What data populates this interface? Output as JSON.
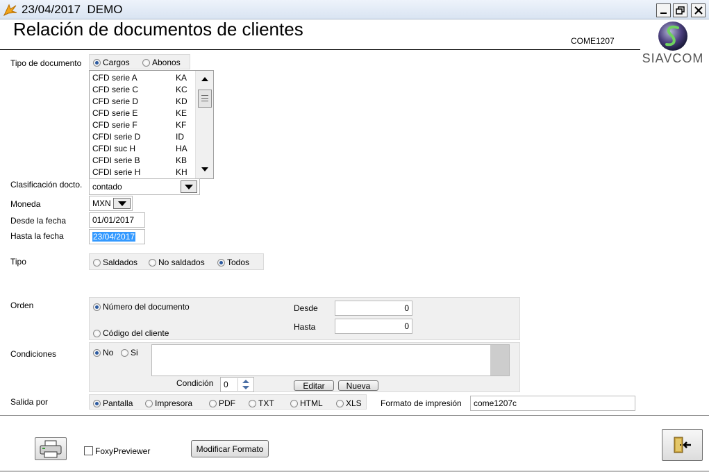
{
  "window": {
    "title": "23/04/2017  DEMO"
  },
  "header": {
    "title": "Relación de documentos de clientes",
    "form_code": "COME1207",
    "logo_text": "SIAVCOM"
  },
  "tipo_documento": {
    "label": "Tipo de documento",
    "options": [
      "Cargos",
      "Abonos"
    ],
    "selected": "Cargos",
    "list": [
      {
        "name": "CFD serie A",
        "code": "KA"
      },
      {
        "name": "CFD serie C",
        "code": "KC"
      },
      {
        "name": "CFD serie D",
        "code": "KD"
      },
      {
        "name": "CFD serie E",
        "code": "KE"
      },
      {
        "name": "CFD serie F",
        "code": "KF"
      },
      {
        "name": "CFDI  serie D",
        "code": "ID"
      },
      {
        "name": "CFDI  suc  H",
        "code": "HA"
      },
      {
        "name": "CFDI serie B",
        "code": "KB"
      },
      {
        "name": "CFDI serie H",
        "code": "KH"
      }
    ]
  },
  "clasificacion": {
    "label": "Clasificación docto.",
    "value": "contado"
  },
  "moneda": {
    "label": "Moneda",
    "value": "MXN"
  },
  "desde_fecha": {
    "label": "Desde la fecha",
    "value": "01/01/2017"
  },
  "hasta_fecha": {
    "label": "Hasta la fecha",
    "value": "23/04/2017"
  },
  "tipo": {
    "label": "Tipo",
    "options": [
      "Saldados",
      "No saldados",
      "Todos"
    ],
    "selected": "Todos"
  },
  "orden": {
    "label": "Orden",
    "options": [
      "Número del documento",
      "Código del cliente"
    ],
    "selected": "Número del documento",
    "desde_label": "Desde",
    "desde_value": "0",
    "hasta_label": "Hasta",
    "hasta_value": "0"
  },
  "condiciones": {
    "label": "Condiciones",
    "options": [
      "No",
      "Si"
    ],
    "selected": "No",
    "condicion_label": "Condición",
    "condicion_value": "0",
    "editar_label": "Editar",
    "nueva_label": "Nueva"
  },
  "salida": {
    "label": "Salida por",
    "options": [
      "Pantalla",
      "Impresora",
      "PDF",
      "TXT",
      "HTML",
      "XLS"
    ],
    "selected": "Pantalla",
    "formato_label": "Formato de impresión",
    "formato_value": "come1207c"
  },
  "footer": {
    "foxy_label": "FoxyPreviewer",
    "foxy_checked": false,
    "modificar_label": "Modificar Formato"
  },
  "colors": {
    "selection": "#3399ff",
    "group_bg": "#f0f0f0",
    "accent_radio": "#2c5aa0"
  },
  "icons": [
    "app-icon",
    "minimize-icon",
    "restore-icon",
    "close-icon",
    "printer-icon",
    "exit-door-icon",
    "siavcom-logo"
  ]
}
